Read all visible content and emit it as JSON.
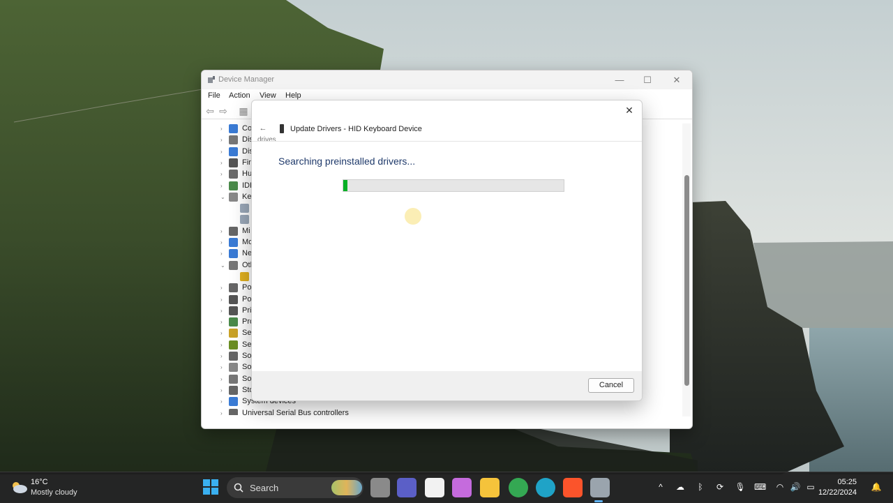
{
  "window": {
    "title": "Device Manager",
    "menu": [
      "File",
      "Action",
      "View",
      "Help"
    ],
    "tree": [
      {
        "label": "Co",
        "arrow": "›",
        "color": "#3a7bd5"
      },
      {
        "label": "Dis",
        "arrow": "›",
        "color": "#777777"
      },
      {
        "label": "Dis",
        "arrow": "›",
        "color": "#3a7bd5"
      },
      {
        "label": "Firr",
        "arrow": "›",
        "color": "#555555"
      },
      {
        "label": "Hu",
        "arrow": "›",
        "color": "#6a6a6a"
      },
      {
        "label": "IDE",
        "arrow": "›",
        "color": "#4a8a4a"
      },
      {
        "label": "Key",
        "arrow": "⌄",
        "color": "#888888"
      },
      {
        "label": "",
        "arrow": "",
        "color": "#9aa8b8"
      },
      {
        "label": "",
        "arrow": "",
        "color": "#9aa8b8"
      },
      {
        "label": "Mi",
        "arrow": "›",
        "color": "#666666"
      },
      {
        "label": "Mo",
        "arrow": "›",
        "color": "#3a7bd5"
      },
      {
        "label": "Ne",
        "arrow": "›",
        "color": "#3a7bd5"
      },
      {
        "label": "Oth",
        "arrow": "⌄",
        "color": "#777777"
      },
      {
        "label": "",
        "arrow": "",
        "color": "#e0b020"
      },
      {
        "label": "Por",
        "arrow": "›",
        "color": "#666666"
      },
      {
        "label": "Por",
        "arrow": "›",
        "color": "#555555"
      },
      {
        "label": "Prin",
        "arrow": "›",
        "color": "#555555"
      },
      {
        "label": "Pro",
        "arrow": "›",
        "color": "#4a8a4a"
      },
      {
        "label": "Sec",
        "arrow": "›",
        "color": "#c9a227"
      },
      {
        "label": "Ser",
        "arrow": "›",
        "color": "#6b8e23"
      },
      {
        "label": "Sof",
        "arrow": "›",
        "color": "#666666"
      },
      {
        "label": "Sof",
        "arrow": "›",
        "color": "#888888"
      },
      {
        "label": "Sou",
        "arrow": "›",
        "color": "#777777"
      },
      {
        "label": "Sto",
        "arrow": "›",
        "color": "#666666"
      },
      {
        "label": "System devices",
        "arrow": "›",
        "color": "#3a7bd5"
      },
      {
        "label": "Universal Serial Bus controllers",
        "arrow": "›",
        "color": "#666666"
      }
    ]
  },
  "dialog": {
    "header": "Update Drivers - HID Keyboard Device",
    "ghost_text": "drives",
    "status": "Searching preinstalled drivers...",
    "progress": 0.02,
    "cancel_label": "Cancel"
  },
  "taskbar": {
    "weather_temp": "16°C",
    "weather_cond": "Mostly cloudy",
    "search_label": "Search",
    "time": "05:25",
    "date": "12/22/2024",
    "apps": [
      {
        "name": "task-view",
        "color": "#8a8a8a"
      },
      {
        "name": "teams",
        "color": "#5b5fc7"
      },
      {
        "name": "microsoft-store",
        "color": "#f2f2f2"
      },
      {
        "name": "copilot",
        "color": "#c56bdd"
      },
      {
        "name": "file-explorer",
        "color": "#f5c33b"
      },
      {
        "name": "chrome",
        "color": "#34a853"
      },
      {
        "name": "edge",
        "color": "#1fa3c7"
      },
      {
        "name": "brave",
        "color": "#fb542b"
      },
      {
        "name": "device-manager",
        "color": "#9aa4ad"
      }
    ]
  },
  "colors": {
    "accent": "#06b025",
    "progress_track": "#e6e6e6"
  }
}
